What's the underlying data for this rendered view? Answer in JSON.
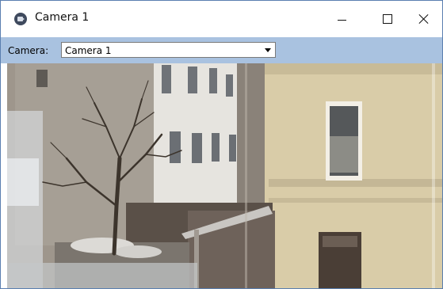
{
  "window": {
    "title": "Camera 1",
    "icon": "webcam-icon",
    "controls": [
      "minimize-icon",
      "maximize-icon",
      "close-icon"
    ]
  },
  "toolbar": {
    "camera_label": "Camera:",
    "camera_select_value": "Camera 1"
  },
  "colors": {
    "toolbar_bg": "#a9c2e0",
    "window_border": "#5a7fb0"
  },
  "view": {
    "content": "live camera feed image"
  }
}
